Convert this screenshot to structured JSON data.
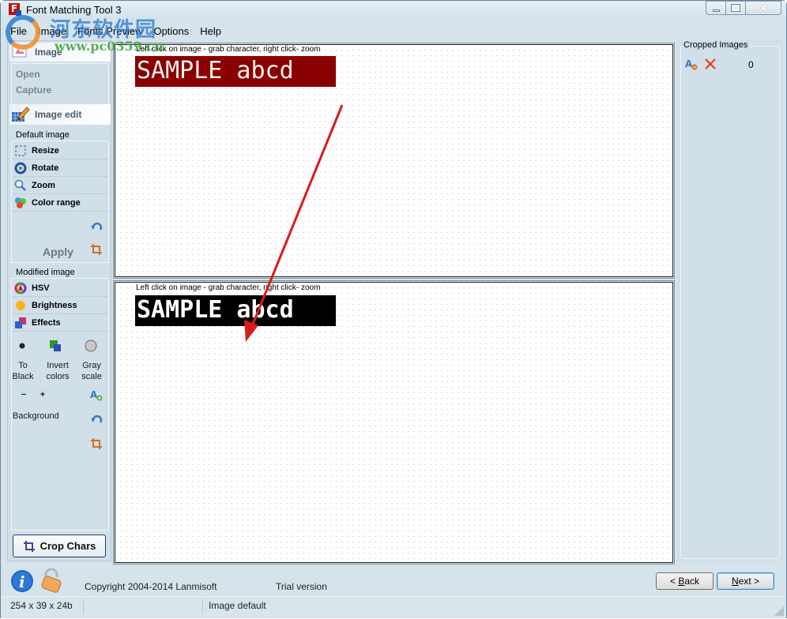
{
  "window": {
    "title": "Font Matching Tool 3",
    "controls": {
      "minimize": "minimize",
      "maximize": "maximize",
      "close": "close"
    }
  },
  "menu": [
    "File",
    "Image",
    "Fonts Preview",
    "Options",
    "Help"
  ],
  "watermark": {
    "brand": "河东软件园",
    "url": "www.pc0359.cn"
  },
  "left_panel": {
    "image_section": {
      "title": "Image",
      "links": [
        "Open",
        "Capture"
      ]
    },
    "edit_section": {
      "title": "Image edit"
    },
    "default_image": {
      "label": "Default image",
      "tools": [
        {
          "label": "Resize",
          "icon": "resize-icon"
        },
        {
          "label": "Rotate",
          "icon": "rotate-icon"
        },
        {
          "label": "Zoom",
          "icon": "zoom-icon"
        },
        {
          "label": "Color range",
          "icon": "color-range-icon"
        }
      ],
      "apply_label": "Apply"
    },
    "modified_image": {
      "label": "Modified image",
      "tools": [
        {
          "label": "HSV",
          "icon": "hsv-icon"
        },
        {
          "label": "Brightness",
          "icon": "brightness-icon"
        },
        {
          "label": "Effects",
          "icon": "effects-icon"
        }
      ],
      "actions": [
        {
          "label_line1": "To",
          "label_line2": "Black"
        },
        {
          "label_line1": "Invert",
          "label_line2": "colors"
        },
        {
          "label_line1": "Gray",
          "label_line2": "scale"
        }
      ],
      "minus": "−",
      "plus": "+",
      "background_label": "Background"
    },
    "crop_chars_label": "Crop Chars"
  },
  "canvas": {
    "hint": "Left click on image - grab character, right click- zoom",
    "sample_text": "SAMPLE abcd",
    "colors": {
      "top_bg": "#8a0000",
      "bottom_bg": "#000000",
      "arrow": "#d81c1c"
    }
  },
  "right_panel": {
    "title": "Cropped Images",
    "count": "0"
  },
  "footer": {
    "copyright": "Copyright 2004-2014 Lanmisoft",
    "trial": "Trial version",
    "back_prefix": "< ",
    "back_u": "B",
    "back_rest": "ack",
    "next_u": "N",
    "next_rest": "ext >"
  },
  "status": {
    "dimensions": "254 x 39 x 24b",
    "middle": "",
    "mode": "Image default"
  }
}
